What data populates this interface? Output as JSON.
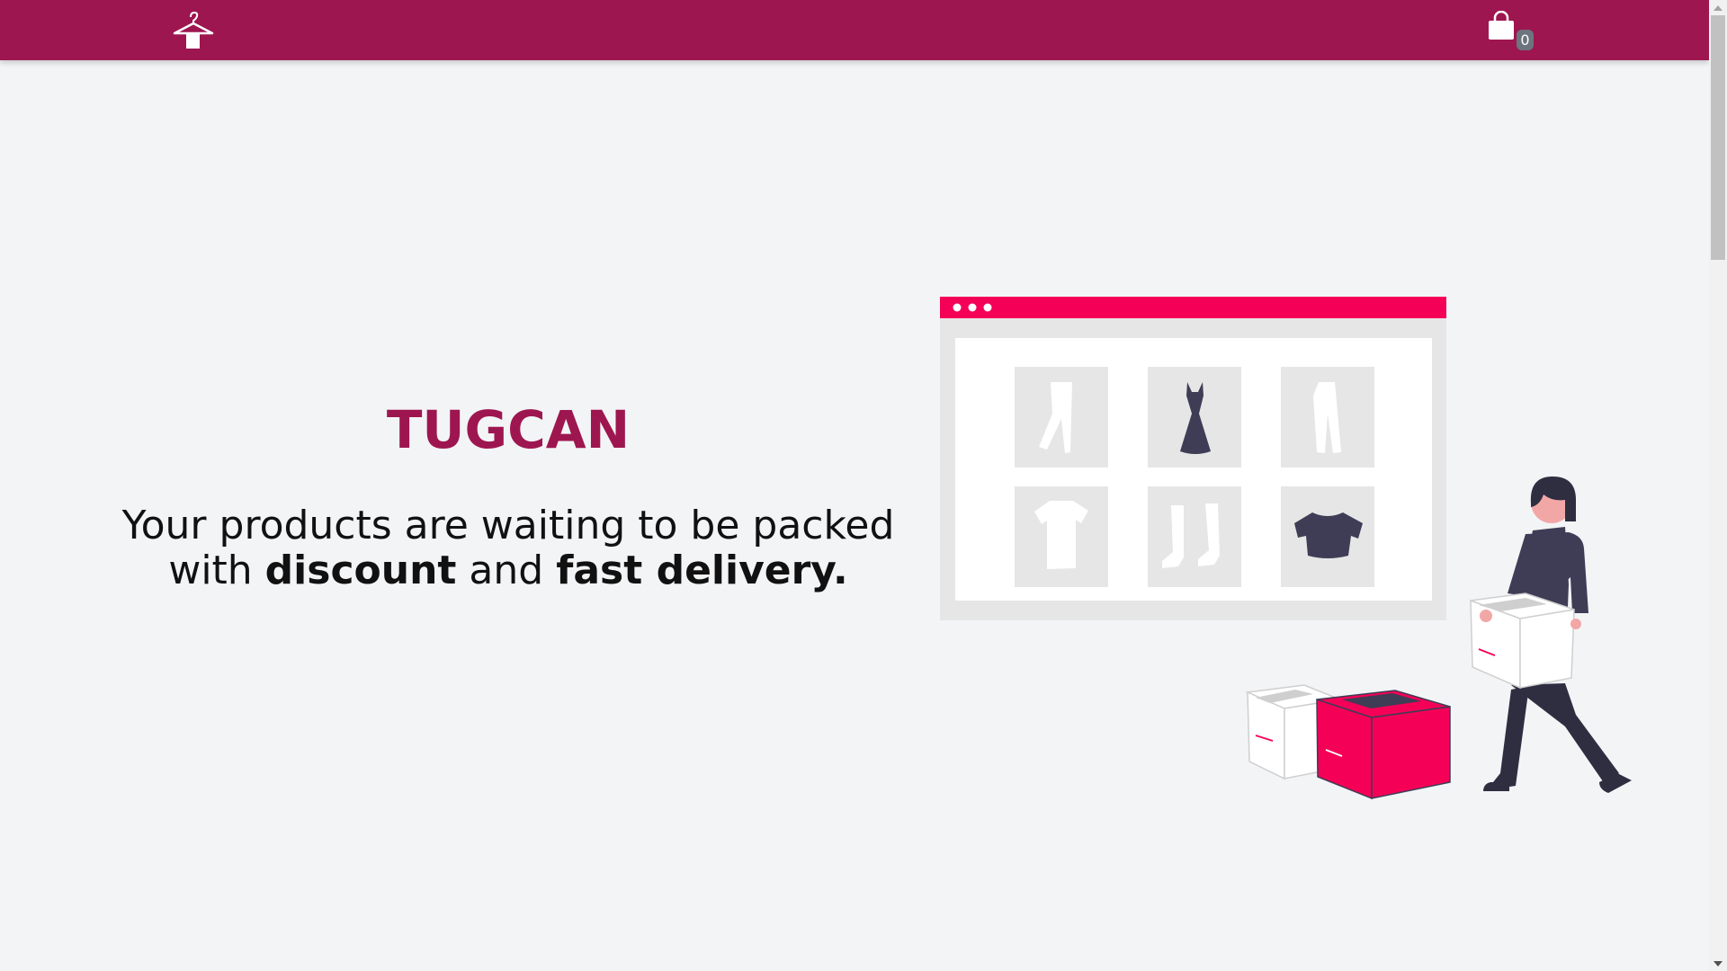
{
  "navbar": {
    "background": "#9e1650",
    "logo_icon": "clothes-hanger-icon",
    "cart_icon": "shopping-bag-icon",
    "cart_count": "0"
  },
  "hero": {
    "title": "TUGCAN",
    "tagline_line1": "Your products are waiting to be packed",
    "tagline_prefix": "with ",
    "tagline_discount": "discount",
    "tagline_middle": " and ",
    "tagline_fast_delivery": "fast delivery."
  },
  "colors": {
    "brand": "#9e1650",
    "accent": "#f50057",
    "dark": "#3f3d56",
    "page_background": "#f3f4f6"
  },
  "illustration": {
    "subject": "online-shopping-illustration"
  }
}
